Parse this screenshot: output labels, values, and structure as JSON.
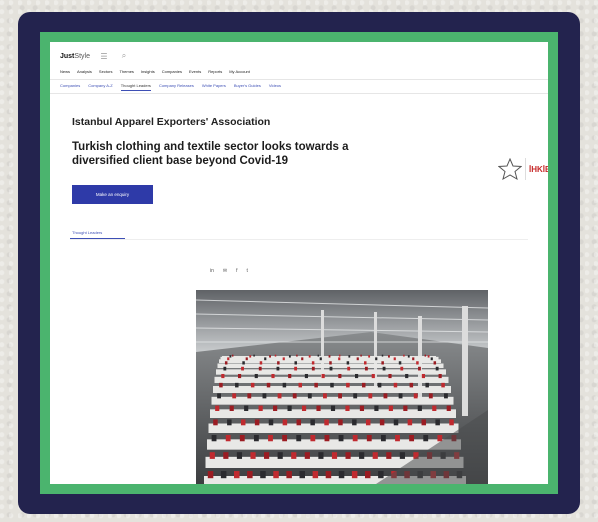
{
  "site": {
    "logo_bold": "Just",
    "logo_light": "Style"
  },
  "icons": {
    "menu": "☰",
    "search": "⌕",
    "share": [
      "in",
      "✉",
      "f",
      "t"
    ]
  },
  "nav": {
    "items": [
      "News",
      "Analysis",
      "Sectors",
      "Themes",
      "Insights",
      "Companies",
      "Events",
      "Reports",
      "My Account"
    ]
  },
  "subnav": {
    "items": [
      "Companies",
      "Company A-Z",
      "Thought Leaders",
      "Company Releases",
      "White Papers",
      "Buyer's Guides",
      "Videos"
    ],
    "active": "Thought Leaders"
  },
  "company": {
    "name": "Istanbul Apparel Exporters' Association",
    "brand_text": "İHKİB"
  },
  "article": {
    "headline": "Turkish clothing and textile sector looks towards a diversified client base beyond Covid-19"
  },
  "cta": {
    "label": "Make an enquiry"
  },
  "tab": {
    "label": "Thought Leaders"
  },
  "colors": {
    "navy_frame": "#23234e",
    "green_frame": "#4bb46e",
    "button": "#2e3aa8",
    "link": "#3d4fb5",
    "brand_red": "#c62828"
  }
}
